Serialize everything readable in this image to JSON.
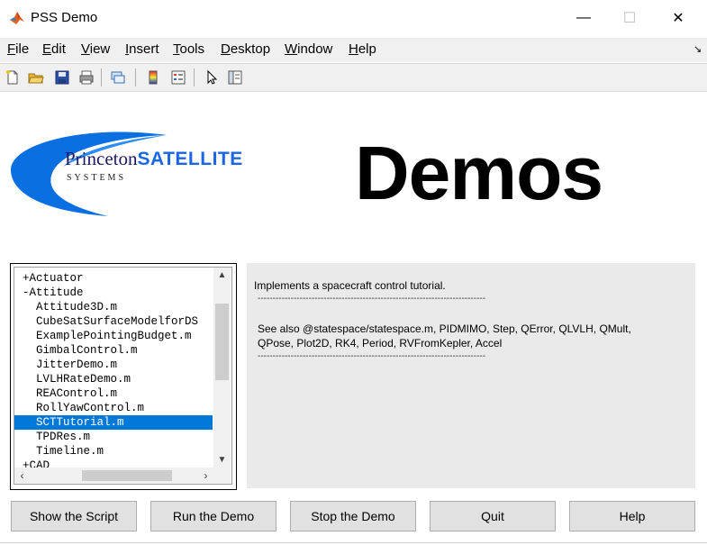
{
  "window": {
    "title": "PSS Demo",
    "icon": "matlab-icon",
    "controls": {
      "minimize": "—",
      "maximize": "☐",
      "close": "✕"
    }
  },
  "menu": {
    "items": [
      {
        "key": "F",
        "rest": "ile"
      },
      {
        "key": "E",
        "rest": "dit"
      },
      {
        "key": "V",
        "rest": "iew"
      },
      {
        "key": "I",
        "rest": "nsert"
      },
      {
        "key": "T",
        "rest": "ools"
      },
      {
        "key": "D",
        "rest": "esktop"
      },
      {
        "key": "W",
        "rest": "indow"
      },
      {
        "key": "H",
        "rest": "elp"
      }
    ],
    "dock_icon": "dock-arrow-icon",
    "dock_glyph": "↘"
  },
  "toolbar": {
    "buttons": [
      "new-file-icon",
      "open-folder-icon",
      "save-icon",
      "print-icon",
      "link-plot-icon",
      "colorbar-icon",
      "legend-icon",
      "pointer-icon",
      "property-inspector-icon"
    ]
  },
  "logo": {
    "line1_a": "Princeton",
    "line1_b": "SATELLITE",
    "line2": "SYSTEMS",
    "swoosh_color": "#0a6fe0"
  },
  "header": {
    "title": "Demos"
  },
  "tree": {
    "items": [
      {
        "text": "+Actuator",
        "indent": 0
      },
      {
        "text": "-Attitude",
        "indent": 0
      },
      {
        "text": "Attitude3D.m",
        "indent": 1
      },
      {
        "text": "CubeSatSurfaceModelforDS",
        "indent": 1
      },
      {
        "text": "ExamplePointingBudget.m",
        "indent": 1
      },
      {
        "text": "GimbalControl.m",
        "indent": 1
      },
      {
        "text": "JitterDemo.m",
        "indent": 1
      },
      {
        "text": "LVLHRateDemo.m",
        "indent": 1
      },
      {
        "text": "REAControl.m",
        "indent": 1
      },
      {
        "text": "RollYawControl.m",
        "indent": 1
      },
      {
        "text": "SCTTutorial.m",
        "indent": 1,
        "selected": true
      },
      {
        "text": "TPDRes.m",
        "indent": 1
      },
      {
        "text": "Timeline.m",
        "indent": 1
      },
      {
        "text": "+CAD",
        "indent": 0
      }
    ],
    "selection_color": "#0078d7"
  },
  "info": {
    "description": "Implements a spacecraft control tutorial.",
    "divider": "----------------------------------------------------------------------------",
    "see_also_1": "See also @statespace/statespace.m, PIDMIMO, Step, QError, QLVLH, QMult,",
    "see_also_2": "QPose, Plot2D, RK4, Period, RVFromKepler, Accel"
  },
  "buttons": {
    "show_script": "Show the Script",
    "run_demo": "Run the Demo",
    "stop_demo": "Stop the Demo",
    "quit": "Quit",
    "help": "Help"
  }
}
